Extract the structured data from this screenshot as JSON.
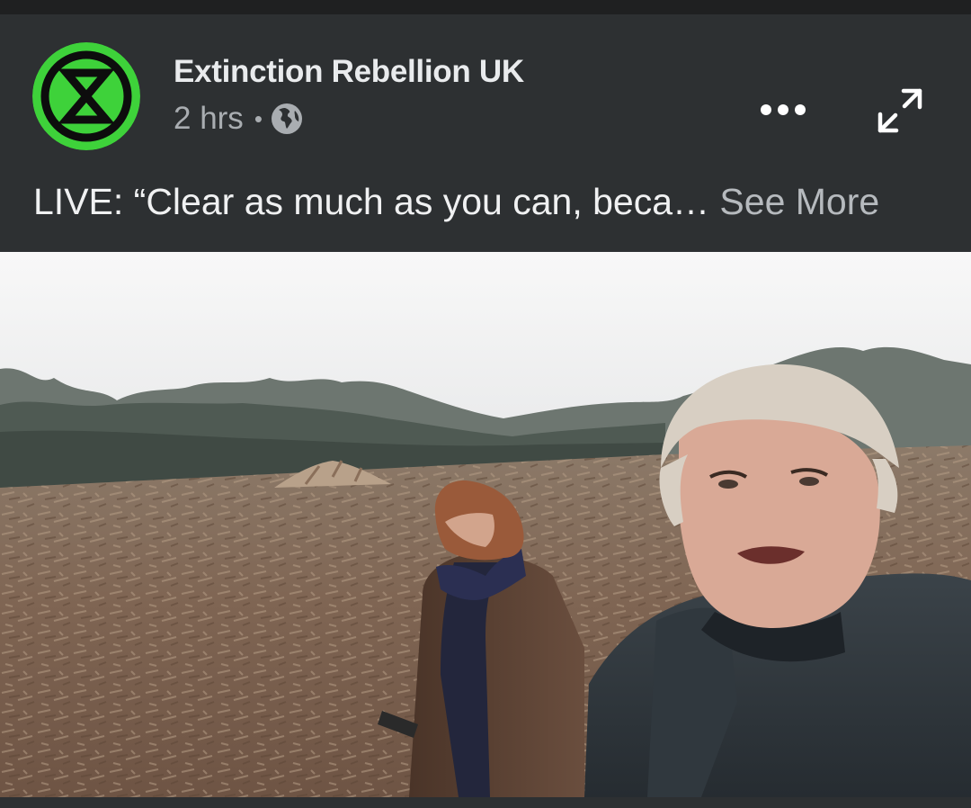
{
  "post": {
    "author": "Extinction Rebellion UK",
    "timestamp": "2 hrs",
    "separator": "•",
    "audience_icon": "globe-icon",
    "caption": "LIVE: “Clear as much as you can, beca…",
    "see_more_label": "See More"
  },
  "header_actions": {
    "more_icon": "more-horizontal-icon",
    "expand_icon": "expand-icon"
  },
  "colors": {
    "header_bg": "#2d3032",
    "logo_green": "#3ed23a",
    "text_primary": "#e9ebed",
    "text_secondary": "#a9adb1"
  }
}
